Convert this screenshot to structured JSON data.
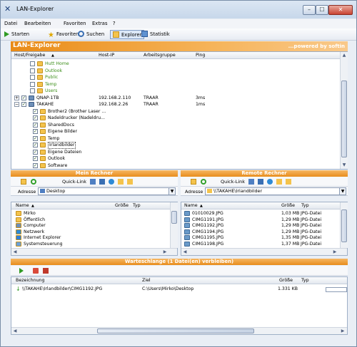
{
  "window": {
    "title": "LAN-Explorer",
    "min": "–",
    "max": "☐",
    "close": "✕"
  },
  "menu": [
    "Datei",
    "Bearbeiten",
    "Favoriten",
    "Extras",
    "?"
  ],
  "toolbar": {
    "start": "Starten",
    "favorites": "Favoriten",
    "search": "Suchen",
    "explorer": "Explorer",
    "stats": "Statistik"
  },
  "banner": {
    "left": "LAN-Explorer",
    "right": "...powered by softin"
  },
  "tree": {
    "headers": {
      "host": "Host/Freigabe",
      "ip": "Host-IP",
      "group": "Arbeitsgruppe",
      "ping": "Ping"
    },
    "rows": [
      {
        "label": "Hutt Home",
        "indent": 2,
        "green": true
      },
      {
        "label": "Outlook",
        "indent": 2,
        "green": true
      },
      {
        "label": "Public",
        "indent": 2,
        "green": true
      },
      {
        "label": "Temp",
        "indent": 2,
        "green": true
      },
      {
        "label": "Users",
        "indent": 2,
        "green": true
      },
      {
        "label": "QNAP-1TB",
        "indent": 0,
        "ip": "192.168.2.110",
        "group": "TRAAR",
        "ping": "3ms",
        "expander": "+"
      },
      {
        "label": "TAKAHE",
        "indent": 0,
        "ip": "192.168.2.26",
        "group": "TRAAR",
        "ping": "1ms",
        "expander": "−"
      },
      {
        "label": "Brother2 (Brother Laser ...",
        "indent": 1
      },
      {
        "label": "Nadeldrucker (Nadeldru...",
        "indent": 1
      },
      {
        "label": "SharedDocs",
        "indent": 1
      },
      {
        "label": "Eigene Bilder",
        "indent": 1
      },
      {
        "label": "Temp",
        "indent": 1
      },
      {
        "label": "Irlandbilder",
        "indent": 1,
        "selected": true
      },
      {
        "label": "Eigene Dateien",
        "indent": 1
      },
      {
        "label": "Outlook",
        "indent": 1
      },
      {
        "label": "Software",
        "indent": 1
      }
    ]
  },
  "local": {
    "title": "Mein Rechner",
    "quicklink": "Quick-Link",
    "address_label": "Adresse",
    "address": "Desktop",
    "headers": {
      "name": "Name",
      "size": "Größe",
      "type": "Typ"
    },
    "rows": [
      "Mirko",
      "Öffentlich",
      "Computer",
      "Netzwerk",
      "Internet Explorer",
      "Systemsteuerung"
    ]
  },
  "remote": {
    "title": "Remote Rechner",
    "quicklink": "Quick-Link",
    "address_label": "Adresse",
    "address": "\\\\TAKAHE\\Irlandbilder",
    "headers": {
      "name": "Name",
      "size": "Größe",
      "type": "Typ"
    },
    "rows": [
      {
        "name": "01010029.JPG",
        "size": "1,03 MB",
        "type": "JPG-Datei"
      },
      {
        "name": "CIMG1191.JPG",
        "size": "1,29 MB",
        "type": "JPG-Datei"
      },
      {
        "name": "CIMG1192.JPG",
        "size": "1,29 MB",
        "type": "JPG-Datei"
      },
      {
        "name": "CIMG1194.JPG",
        "size": "1,29 MB",
        "type": "JPG-Datei"
      },
      {
        "name": "CIMG1195.JPG",
        "size": "1,35 MB",
        "type": "JPG-Datei"
      },
      {
        "name": "CIMG1198.JPG",
        "size": "1,37 MB",
        "type": "JPG-Datei"
      }
    ]
  },
  "queue": {
    "title": "Warteschlange (1 Datei(en) verbleiben)",
    "headers": {
      "desc": "Bezeichnung",
      "target": "Ziel",
      "size": "Größe",
      "type": "Typ"
    },
    "rows": [
      {
        "desc": "\\\\TAKAHE\\Irlandbilder\\CIMG1192.JPG",
        "target": "C:\\Users\\Mirko\\Desktop",
        "size": "1.331 KB"
      }
    ]
  }
}
